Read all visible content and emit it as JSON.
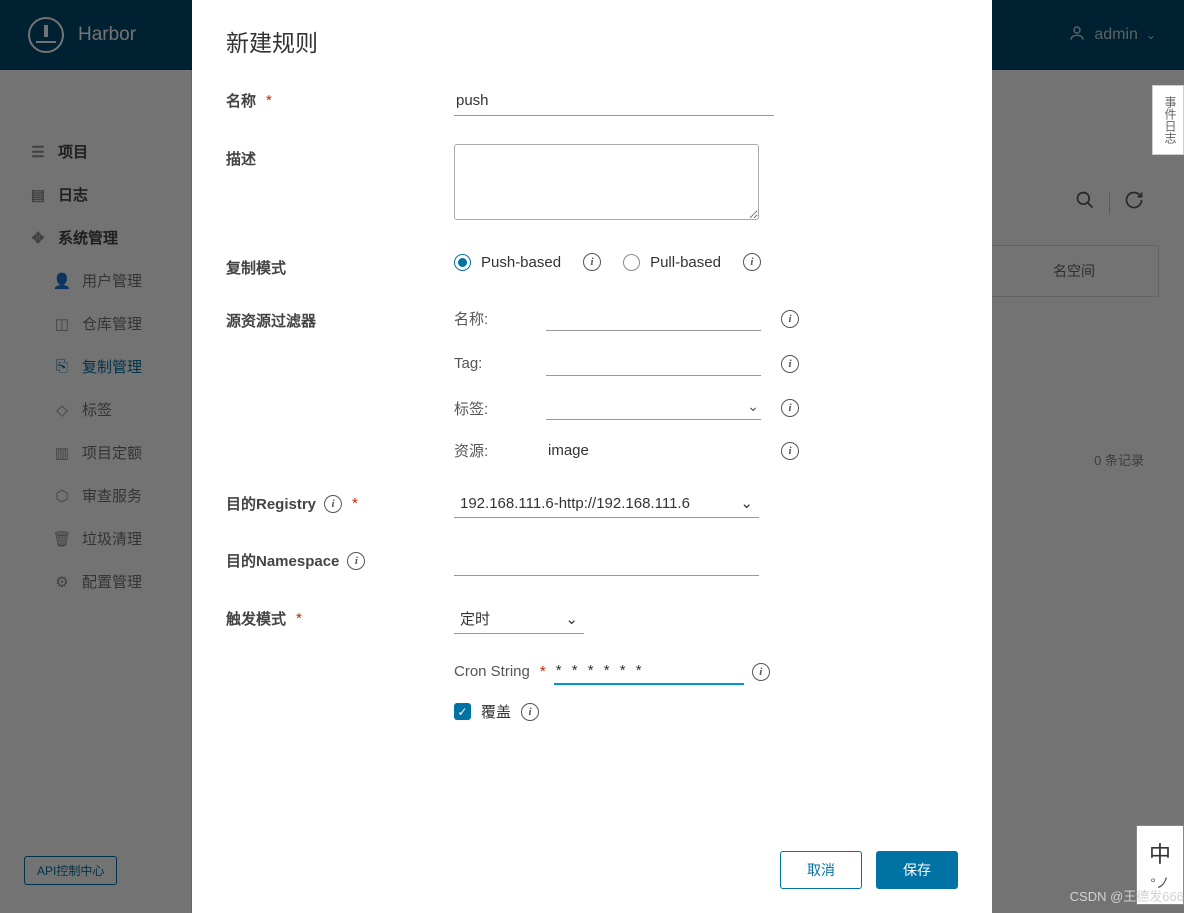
{
  "header": {
    "brand": "Harbor",
    "user": "admin"
  },
  "sidebar": {
    "items": [
      {
        "label": "项目"
      },
      {
        "label": "日志"
      },
      {
        "label": "系统管理"
      },
      {
        "label": "用户管理"
      },
      {
        "label": "仓库管理"
      },
      {
        "label": "复制管理"
      },
      {
        "label": "标签"
      },
      {
        "label": "项目定额"
      },
      {
        "label": "审查服务"
      },
      {
        "label": "垃圾清理"
      },
      {
        "label": "配置管理"
      }
    ],
    "api_button": "API控制中心"
  },
  "bg": {
    "column_header": "名空间",
    "records": "0 条记录"
  },
  "dialog": {
    "title": "新建规则",
    "labels": {
      "name": "名称",
      "description": "描述",
      "replication_mode": "复制模式",
      "source_filter": "源资源过滤器",
      "dest_registry": "目的Registry",
      "dest_namespace": "目的Namespace",
      "trigger_mode": "触发模式",
      "cron_string": "Cron String",
      "override": "覆盖"
    },
    "values": {
      "name": "push",
      "description": "",
      "push_based": "Push-based",
      "pull_based": "Pull-based",
      "filter_name_label": "名称:",
      "filter_tag_label": "Tag:",
      "filter_label_label": "标签:",
      "filter_resource_label": "资源:",
      "filter_resource_value": "image",
      "dest_registry": "192.168.111.6-http://192.168.111.6",
      "trigger_selected": "定时",
      "cron_value": "* * * * * *",
      "override_checked": true
    },
    "buttons": {
      "cancel": "取消",
      "save": "保存"
    }
  },
  "side": {
    "tab": "事件日志",
    "ime_top": "中",
    "ime_bottom": "°ノ"
  },
  "watermark": "CSDN @王德发666"
}
